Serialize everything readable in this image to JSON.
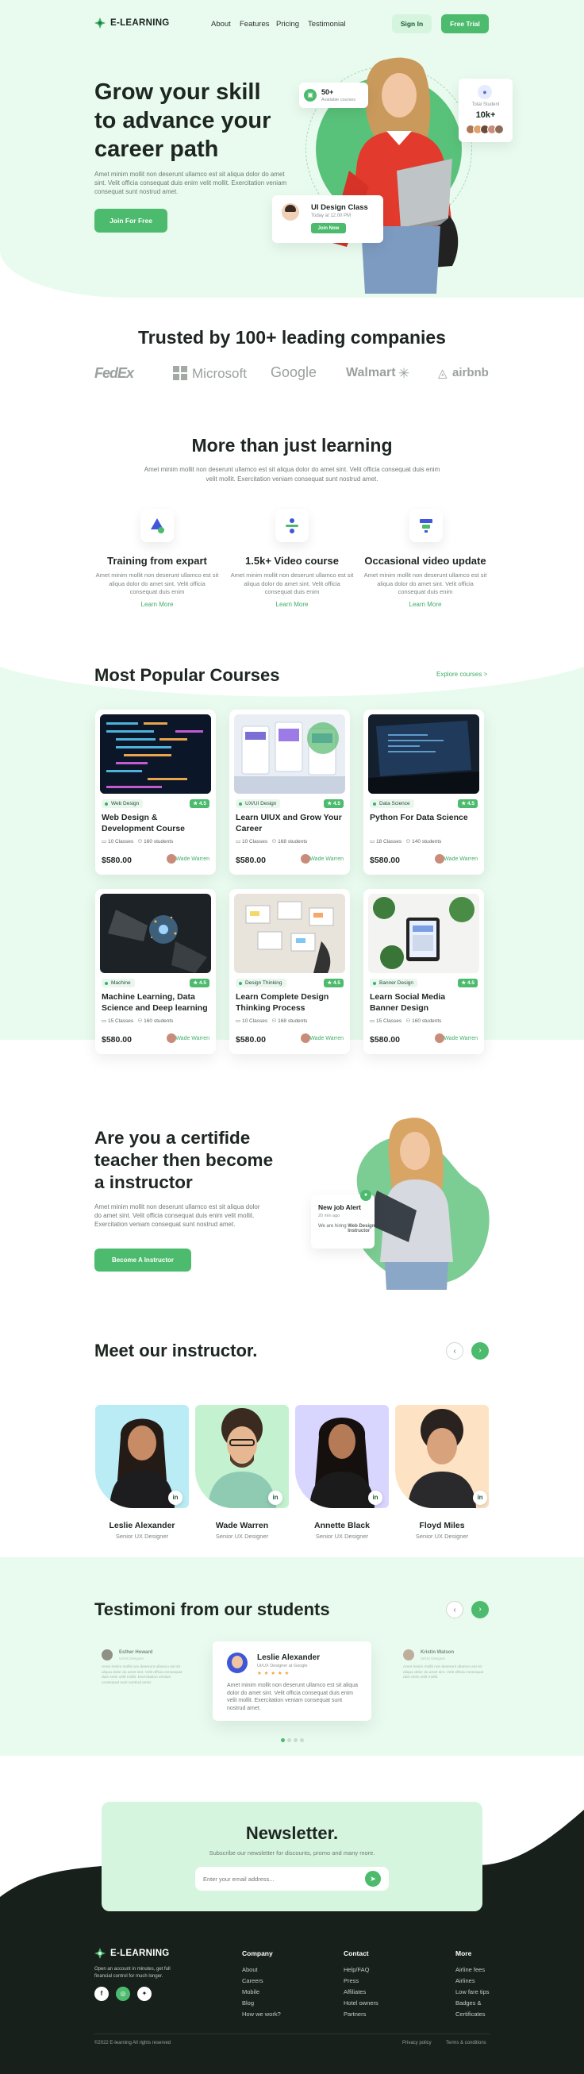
{
  "nav": {
    "logo": "E-LEARNING",
    "links": [
      "About",
      "Features",
      "Pricing",
      "Testimonial"
    ],
    "signin": "Sign In",
    "free_trial": "Free Trial"
  },
  "hero": {
    "title_lines": [
      "Grow your skill",
      "to advance your",
      "career path"
    ],
    "text": "Amet minim mollit non deserunt ullamco est sit aliqua dolor do amet sint. Velit officia consequat duis enim velit mollit. Exercitation veniam consequat sunt nostrud amet.",
    "cta": "Join For Free",
    "badge_courses_num": "50+",
    "badge_courses_label": "Available courses",
    "badge_students_label": "Total Student",
    "badge_students_num": "10k+",
    "class_title": "UI Design Class",
    "class_time": "Today at 12.00 PM",
    "class_button": "Join Now"
  },
  "trusted": {
    "title": "Trusted by 100+ leading companies",
    "companies": [
      "FedEx",
      "Microsoft",
      "Google",
      "Walmart",
      "airbnb"
    ]
  },
  "features": {
    "title": "More than just learning",
    "text": "Amet minim mollit non deserunt ullamco est sit aliqua dolor do amet sint. Velit officia consequat duis enim velit mollit. Exercitation veniam consequat sunt nostrud amet.",
    "items": [
      {
        "title": "Training from expart",
        "text": "Amet minim mollit non deserunt ullamco est sit aliqua dolor do amet sint. Velit officia consequat duis enim",
        "link": "Learn More"
      },
      {
        "title": "1.5k+ Video course",
        "text": "Amet minim mollit non deserunt ullamco est sit aliqua dolor do amet sint. Velit officia consequat duis enim",
        "link": "Learn More"
      },
      {
        "title": "Occasional video update",
        "text": "Amet minim mollit non deserunt ullamco est sit aliqua dolor do amet sint. Velit officia consequat duis enim",
        "link": "Learn More"
      }
    ]
  },
  "courses": {
    "title": "Most Popular Courses",
    "explore": "Explore courses >",
    "items": [
      {
        "tag": "Web Design",
        "rating": "★ 4.5",
        "title": "Web Design & Development Course",
        "classes": "10 Classes",
        "students": "160 students",
        "price": "$580.00",
        "author": "Wade Warren"
      },
      {
        "tag": "UX/UI Design",
        "rating": "★ 4.5",
        "title": "Learn UIUX and Grow Your Career",
        "classes": "10 Classes",
        "students": "168 students",
        "price": "$580.00",
        "author": "Wade Warren"
      },
      {
        "tag": "Data Science",
        "rating": "★ 4.5",
        "title": "Python For Data Science",
        "classes": "18 Classes",
        "students": "140 students",
        "price": "$580.00",
        "author": "Wade Warren"
      },
      {
        "tag": "Machine",
        "rating": "★ 4.5",
        "title": "Machine Learning, Data Science and Deep learning",
        "classes": "15 Classes",
        "students": "160 students",
        "price": "$580.00",
        "author": "Wade Warren"
      },
      {
        "tag": "Design Thinking",
        "rating": "★ 4.5",
        "title": "Learn Complete Design Thinking Process",
        "classes": "10 Classes",
        "students": "168 students",
        "price": "$580.00",
        "author": "Wade Warren"
      },
      {
        "tag": "Banner Design",
        "rating": "★ 4.5",
        "title": "Learn Social Media Banner Design",
        "classes": "15 Classes",
        "students": "160 students",
        "price": "$580.00",
        "author": "Wade Warren"
      }
    ]
  },
  "instructor_cta": {
    "title_lines": [
      "Are you a certifide",
      "teacher then become",
      "a instructor"
    ],
    "text": "Amet minim mollit non deserunt ullamco est sit aliqua dolor do amet sint. Velit officia consequat duis enim velit mollit. Exercitation veniam consequat sunt nostrud amet.",
    "button": "Become A Instructor",
    "alert_title": "New job Alert",
    "alert_time": "20 min ago",
    "alert_text_1": "We are hiring",
    "alert_text_2": "Web Design Instructor"
  },
  "instructors": {
    "title": "Meet our instructor.",
    "items": [
      {
        "name": "Leslie Alexander",
        "role": "Senior UX Designer"
      },
      {
        "name": "Wade Warren",
        "role": "Senior UX Designer"
      },
      {
        "name": "Annette Black",
        "role": "Senior UX Designer"
      },
      {
        "name": "Floyd Miles",
        "role": "Senior UX Designer"
      }
    ]
  },
  "testimonials": {
    "title": "Testimoni from our students",
    "left": {
      "name": "Esther Howard",
      "role": "UI/UX Designer",
      "text": "Amet minim mollit non deserunt ullamco est sit aliqua dolor do amet sint. Velit officia consequat duis enim velit mollit. Exercitation veniam consequat sunt nostrud amet."
    },
    "center": {
      "name": "Leslie Alexander",
      "role": "UI/UX Designer at Google",
      "stars": "★ ★ ★ ★ ★",
      "text": "Amet minim mollit non deserunt ullamco est sit aliqua dolor do amet sint. Velit officia consequat duis enim velit mollit. Exercitation veniam consequat sunt nostrud amet."
    },
    "right": {
      "name": "Kristin Watson",
      "role": "UI/UX Designer",
      "text": "Amet minim mollit non deserunt ullamco est sit aliqua dolor do amet sint. Velit officia consequat duis enim velit mollit."
    }
  },
  "newsletter": {
    "title": "Newsletter.",
    "subtitle": "Subscribe our newsletter for discounts, promo and many more.",
    "placeholder": "Enter your email address..."
  },
  "footer": {
    "logo": "E-LEARNING",
    "about": "Open an account in minutes, get full financial control for much longer.",
    "columns": [
      {
        "head": "Company",
        "links": [
          "About",
          "Careers",
          "Mobile",
          "Blog",
          "How we work?"
        ]
      },
      {
        "head": "Contact",
        "links": [
          "Help/FAQ",
          "Press",
          "Affiliates",
          "Hotel owners",
          "Partners"
        ]
      },
      {
        "head": "More",
        "links": [
          "Airline fees",
          "Airlines",
          "Low fare tips",
          "Badges &",
          "Certificates"
        ]
      }
    ],
    "copyright": "©2022 E-learning All rights reserved",
    "privacy": "Privacy policy",
    "terms": "Terms & conditions"
  },
  "colors": {
    "accent": "#4cbb6d",
    "mint": "#e8fbee",
    "dark": "#17201b"
  }
}
